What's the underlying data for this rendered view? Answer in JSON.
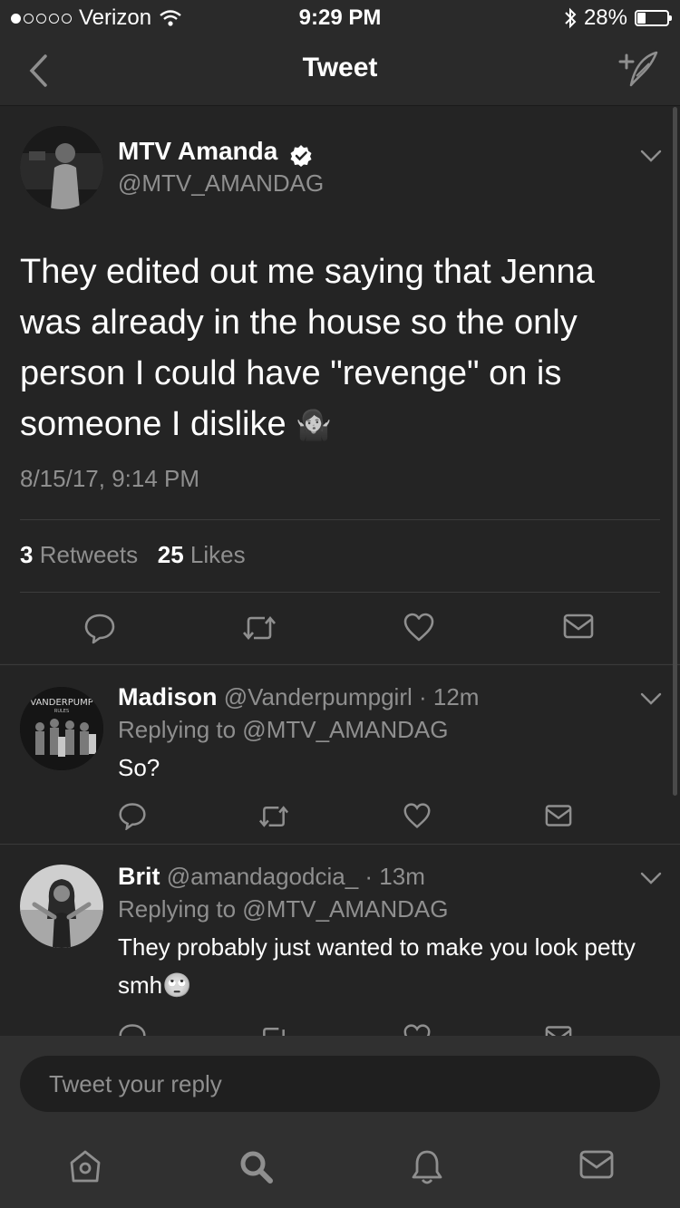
{
  "status_bar": {
    "carrier": "Verizon",
    "time": "9:29 PM",
    "battery": "28%",
    "battery_level": 0.28
  },
  "nav": {
    "title": "Tweet",
    "back_icon": "chevron-left-icon",
    "compose_icon": "compose-tweet-icon"
  },
  "tweet": {
    "author_name": "MTV Amanda",
    "author_handle": "@MTV_AMANDAG",
    "text": "They edited out me saying that Jenna was already in the house so the only person I could have \"revenge\" on is someone I dislike",
    "emoji": "🤷‍♀️",
    "timestamp": "8/15/17, 9:14 PM",
    "retweets_count": "3",
    "retweets_label": "Retweets",
    "likes_count": "25",
    "likes_label": "Likes"
  },
  "replies": [
    {
      "name": "Madison",
      "handle_time": "@Vanderpumpgirl · 12m",
      "replying_to": "Replying to @MTV_AMANDAG",
      "text": "So?",
      "avatar_caption": "VANDERPUMP RULES"
    },
    {
      "name": "Brit",
      "handle_time": "@amandagodcia_ · 13m",
      "replying_to": "Replying to @MTV_AMANDAG",
      "text": "They probably just wanted to make you look petty smh",
      "emoji": "🙄"
    }
  ],
  "composer": {
    "placeholder": "Tweet your reply"
  },
  "tabs": [
    "home-icon",
    "search-icon",
    "notifications-icon",
    "messages-icon"
  ]
}
